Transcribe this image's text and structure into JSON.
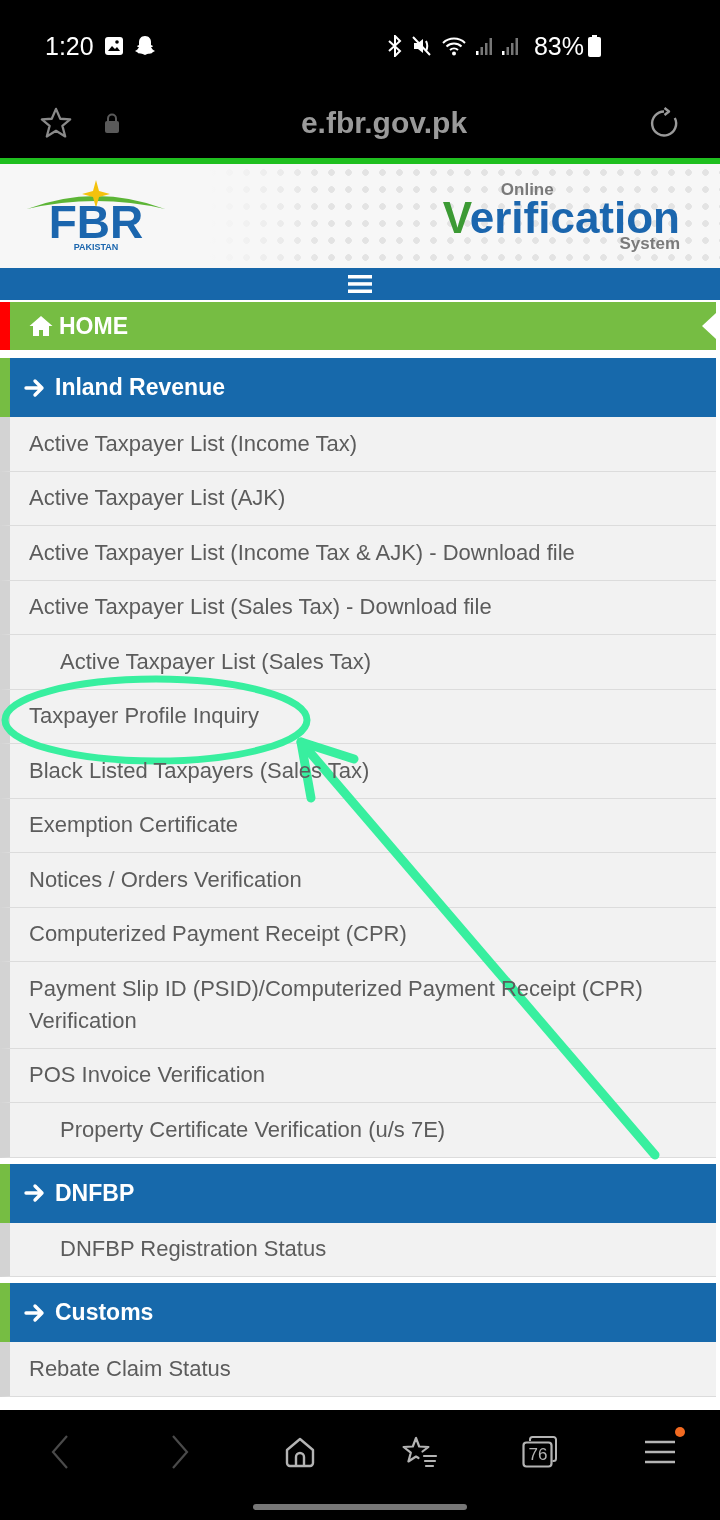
{
  "status_bar": {
    "time": "1:20",
    "battery": "83%"
  },
  "browser": {
    "url": "e.fbr.gov.pk"
  },
  "header": {
    "left_logo": {
      "title": "FBR",
      "subtitle": "PAKISTAN"
    },
    "right_logo": {
      "top": "Online",
      "title": "Verification",
      "bottom": "System"
    }
  },
  "menu": {
    "home": {
      "label": "HOME",
      "selected": true
    },
    "sections": [
      {
        "title": "Inland Revenue",
        "items": [
          {
            "label": "Active Taxpayer List (Income Tax)",
            "kind": "link"
          },
          {
            "label": "Active Taxpayer List (AJK)",
            "kind": "link"
          },
          {
            "label": "Active Taxpayer List (Income Tax & AJK) - Download file",
            "kind": "link"
          },
          {
            "label": "Active Taxpayer List (Sales Tax) - Download file",
            "kind": "link"
          },
          {
            "label": "Active Taxpayer List (Sales Tax)",
            "kind": "sublink"
          },
          {
            "label": "Taxpayer Profile Inquiry",
            "kind": "link"
          },
          {
            "label": "Black Listed Taxpayers (Sales Tax)",
            "kind": "link"
          },
          {
            "label": "Exemption Certificate",
            "kind": "link"
          },
          {
            "label": "Notices / Orders Verification",
            "kind": "link"
          },
          {
            "label": "Computerized Payment Receipt (CPR)",
            "kind": "link"
          },
          {
            "label": "Payment Slip ID (PSID)/Computerized Payment Receipt (CPR) Verification",
            "kind": "link"
          },
          {
            "label": "POS Invoice Verification",
            "kind": "link"
          },
          {
            "label": "Property Certificate Verification (u/s 7E)",
            "kind": "sublink"
          }
        ]
      },
      {
        "title": "DNFBP",
        "items": [
          {
            "label": "DNFBP Registration Status",
            "kind": "sublink"
          }
        ]
      },
      {
        "title": "Customs",
        "items": [
          {
            "label": "Rebate Claim Status",
            "kind": "link"
          }
        ]
      }
    ]
  },
  "bottom_bar": [
    {
      "kind": "back",
      "disabled": true,
      "badge": false
    },
    {
      "kind": "forward",
      "disabled": true,
      "badge": false
    },
    {
      "kind": "home",
      "disabled": false,
      "badge": false
    },
    {
      "kind": "bookmarks",
      "disabled": false,
      "badge": false
    },
    {
      "kind": "tabs",
      "disabled": false,
      "badge": false,
      "count": "76"
    },
    {
      "kind": "menu",
      "disabled": false,
      "badge": true
    }
  ]
}
